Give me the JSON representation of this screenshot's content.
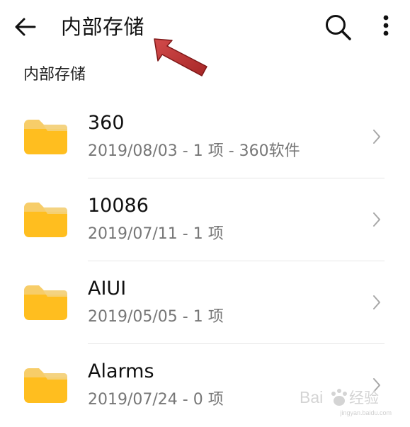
{
  "header": {
    "back_icon": "back-arrow-icon",
    "title": "内部存储",
    "search_icon": "search-icon",
    "more_icon": "more-vertical-icon"
  },
  "breadcrumb": {
    "text": "内部存储"
  },
  "annotation": {
    "icon": "red-arrow-icon",
    "color": "#b83232"
  },
  "files": [
    {
      "name": "360",
      "meta": "2019/08/03 - 1 项 - 360软件"
    },
    {
      "name": "10086",
      "meta": "2019/07/11 - 1 项"
    },
    {
      "name": "AIUI",
      "meta": "2019/05/05 - 1 项"
    },
    {
      "name": "Alarms",
      "meta": "2019/07/24 - 0 项"
    }
  ],
  "watermark": {
    "brand": "Baidu经验",
    "url": "jingyan.baidu.com"
  },
  "colors": {
    "folder": "#ffbe1f",
    "folder_tab": "#f4c85a",
    "text_primary": "#111111",
    "text_secondary": "#777777",
    "divider": "#e6e6e6"
  }
}
